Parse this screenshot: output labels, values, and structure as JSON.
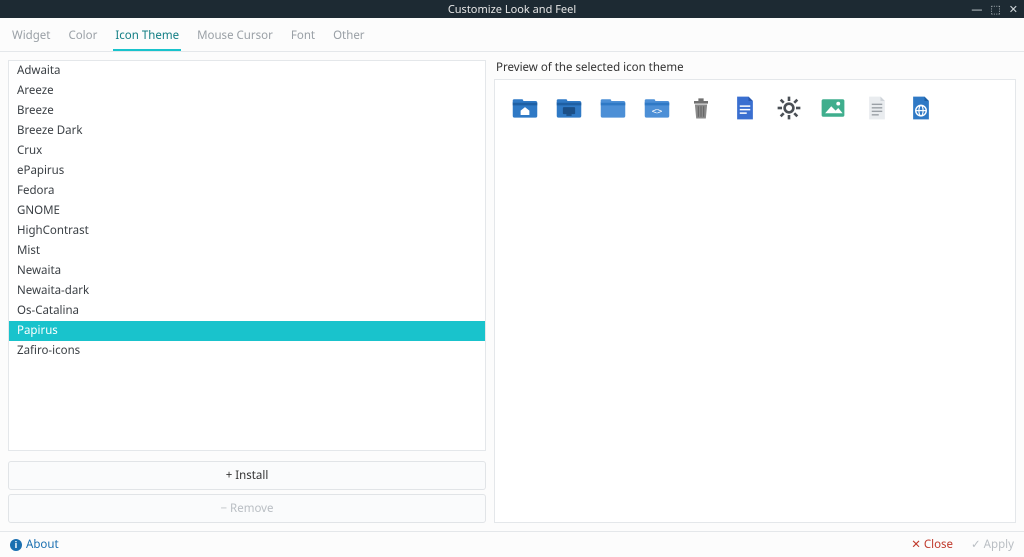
{
  "window": {
    "title": "Customize Look and Feel"
  },
  "tabs": [
    {
      "label": "Widget"
    },
    {
      "label": "Color"
    },
    {
      "label": "Icon Theme",
      "active": true
    },
    {
      "label": "Mouse Cursor"
    },
    {
      "label": "Font"
    },
    {
      "label": "Other"
    }
  ],
  "themes": [
    {
      "name": "Adwaita"
    },
    {
      "name": "Areeze"
    },
    {
      "name": "Breeze"
    },
    {
      "name": "Breeze Dark"
    },
    {
      "name": "Crux"
    },
    {
      "name": "ePapirus"
    },
    {
      "name": "Fedora"
    },
    {
      "name": "GNOME"
    },
    {
      "name": "HighContrast"
    },
    {
      "name": "Mist"
    },
    {
      "name": "Newaita"
    },
    {
      "name": "Newaita-dark"
    },
    {
      "name": "Os-Catalina"
    },
    {
      "name": "Papirus",
      "selected": true
    },
    {
      "name": "Zafiro-icons"
    }
  ],
  "buttons": {
    "install": "+  Install",
    "remove": "−  Remove"
  },
  "preview": {
    "label": "Preview of the selected icon theme",
    "icons": [
      "folder-home-icon",
      "folder-desktop-icon",
      "folder-icon",
      "folder-code-icon",
      "trash-icon",
      "document-icon",
      "settings-icon",
      "image-icon",
      "text-file-icon",
      "html-icon"
    ]
  },
  "footer": {
    "about": "About",
    "close": "Close",
    "apply": "Apply"
  },
  "colors": {
    "folder_blue": "#2f79c5",
    "folder_blue_light": "#4c8fd6",
    "trash_gray": "#707070",
    "doc_blue": "#3a6fd0",
    "gear_gray": "#4a4f55",
    "image_teal": "#3fae8d",
    "text_gray": "#9aa0a6"
  }
}
